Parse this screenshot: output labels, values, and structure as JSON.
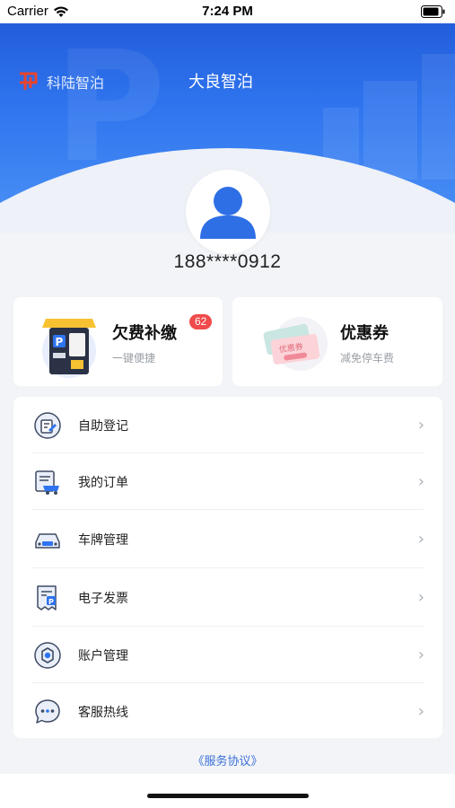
{
  "status": {
    "carrier": "Carrier",
    "time": "7:24 PM"
  },
  "header": {
    "brand_name": "科陆智泊",
    "site_title": "大良智泊"
  },
  "user": {
    "phone": "188****0912"
  },
  "cards": {
    "arrears": {
      "title": "欠费补缴",
      "subtitle": "一键便捷",
      "badge": "62"
    },
    "coupon": {
      "title": "优惠券",
      "subtitle": "减免停车费",
      "art_text": "优惠券"
    }
  },
  "menu": [
    {
      "label": "自助登记",
      "icon": "register-icon"
    },
    {
      "label": "我的订单",
      "icon": "order-icon"
    },
    {
      "label": "车牌管理",
      "icon": "car-icon"
    },
    {
      "label": "电子发票",
      "icon": "invoice-icon"
    },
    {
      "label": "账户管理",
      "icon": "account-settings-icon"
    },
    {
      "label": "客服热线",
      "icon": "chat-support-icon"
    }
  ],
  "footer": {
    "agreement": "《服务协议》"
  },
  "colors": {
    "primary": "#2f74ee",
    "badge": "#f04b4b",
    "link": "#3a6fd8"
  }
}
